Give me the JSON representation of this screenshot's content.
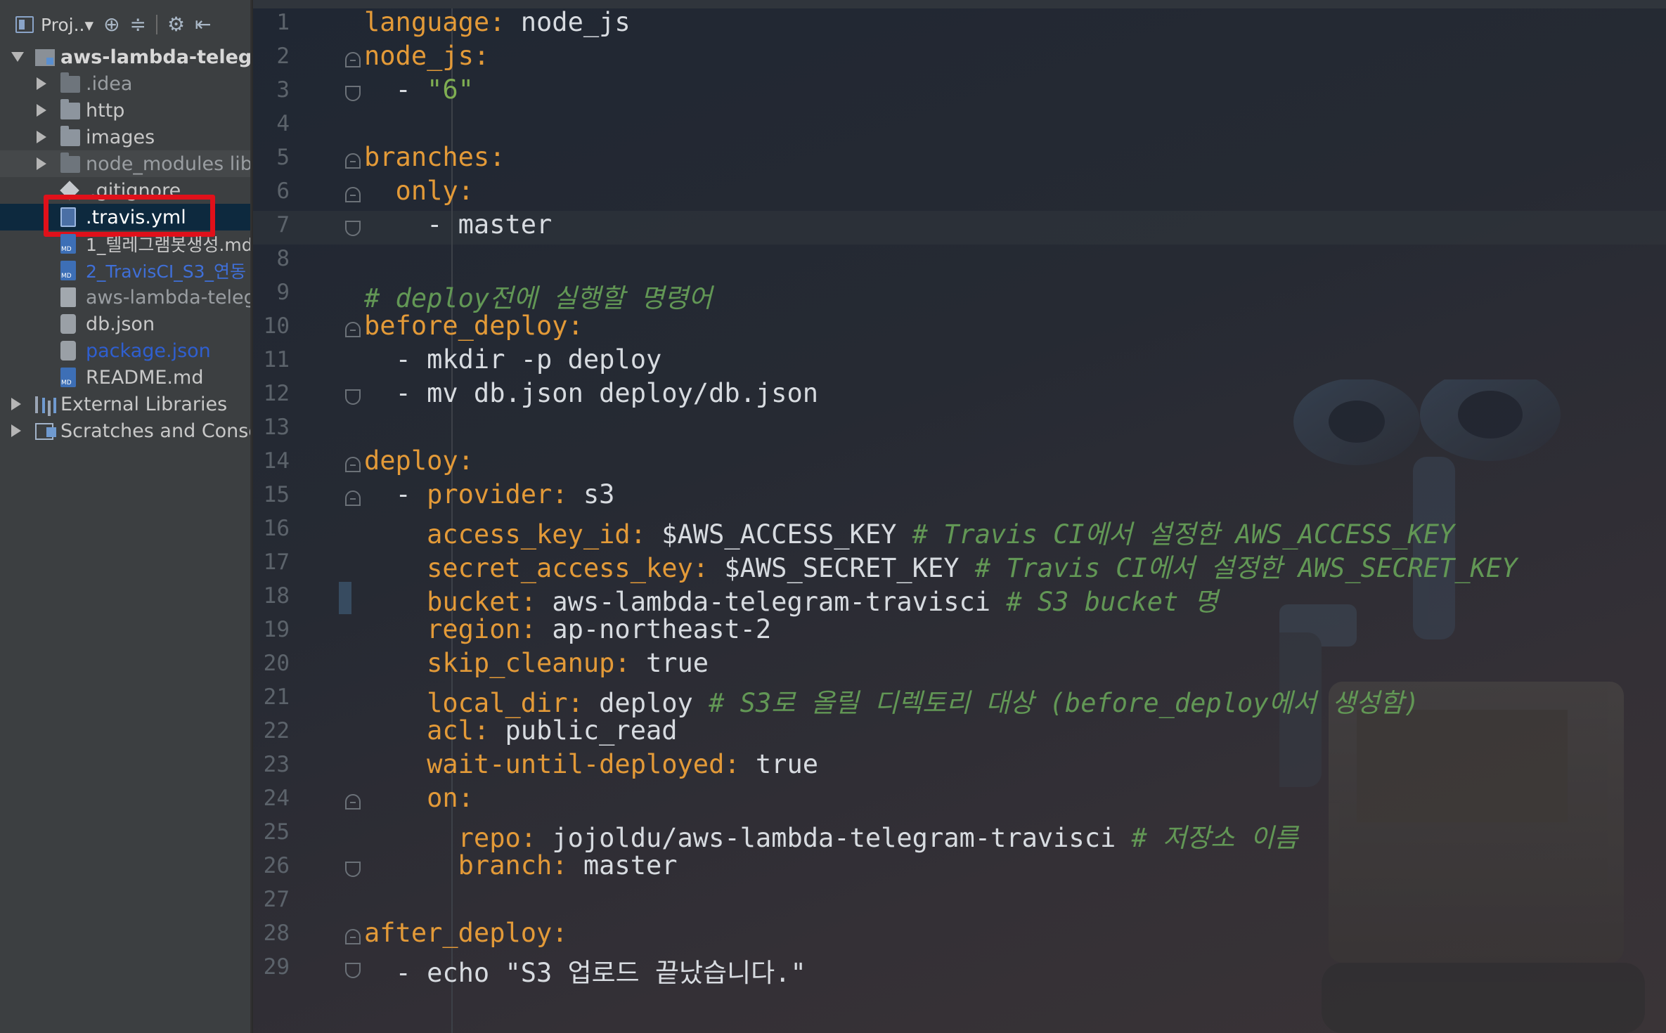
{
  "sidebar": {
    "toolbar": {
      "project_label": "Proj..▾",
      "icons": [
        "locate-icon",
        "collapse-icon",
        "gear-icon",
        "hide-icon"
      ]
    },
    "tree": [
      {
        "label": "aws-lambda-telegra",
        "icon": "project-folder-icon",
        "expanded": true
      },
      {
        "label": ".idea",
        "icon": "folder-icon"
      },
      {
        "label": "http",
        "icon": "folder-icon"
      },
      {
        "label": "images",
        "icon": "folder-icon"
      },
      {
        "label": "node_modules  lib",
        "icon": "folder-icon"
      },
      {
        "label": ".gitignore",
        "icon": "git-file-icon"
      },
      {
        "label": ".travis.yml",
        "icon": "yml-file-icon",
        "selected": true
      },
      {
        "label": "1_텔레그램봇생성.md",
        "icon": "md-file-icon"
      },
      {
        "label": "2_TravisCI_S3_연동",
        "icon": "md-file-icon"
      },
      {
        "label": "aws-lambda-teleg",
        "icon": "file-icon"
      },
      {
        "label": "db.json",
        "icon": "json-file-icon"
      },
      {
        "label": "package.json",
        "icon": "json-file-icon"
      },
      {
        "label": "README.md",
        "icon": "md-file-icon"
      },
      {
        "label": "External Libraries",
        "icon": "library-icon"
      },
      {
        "label": "Scratches and Conso",
        "icon": "scratch-icon"
      }
    ]
  },
  "editor": {
    "line_numbers": [
      "1",
      "2",
      "3",
      "4",
      "5",
      "6",
      "7",
      "8",
      "9",
      "10",
      "11",
      "12",
      "13",
      "14",
      "15",
      "16",
      "17",
      "18",
      "19",
      "20",
      "21",
      "22",
      "23",
      "24",
      "25",
      "26",
      "27",
      "28",
      "29"
    ],
    "code": {
      "l1_key": "language:",
      "l1_val": " node_js",
      "l2_key": "node_js:",
      "l3_dash": "  - ",
      "l3_val": "\"6\"",
      "l5_key": "branches:",
      "l6_key": "  only:",
      "l7_val": "    - master",
      "l9_comment": "# deploy전에 실행할 명령어",
      "l10_key": "before_deploy:",
      "l11_val": "  - mkdir -p deploy",
      "l12_val": "  - mv db.json deploy/db.json",
      "l14_key": "deploy:",
      "l15_dash": "  - ",
      "l15_key": "provider:",
      "l15_val": " s3",
      "l16_key": "    access_key_id:",
      "l16_val": " $AWS_ACCESS_KEY ",
      "l16_comment": "# Travis CI에서 설정한 AWS_ACCESS_KEY",
      "l17_key": "    secret_access_key:",
      "l17_val": " $AWS_SECRET_KEY ",
      "l17_comment": "# Travis CI에서 설정한 AWS_SECRET_KEY",
      "l18_key": "    bucket:",
      "l18_val": " aws-lambda-telegram-travisci ",
      "l18_comment": "# S3 bucket 명",
      "l19_key": "    region:",
      "l19_val": " ap-northeast-2",
      "l20_key": "    skip_cleanup:",
      "l20_val": " true",
      "l21_key": "    local_dir:",
      "l21_val": " deploy ",
      "l21_comment": "# S3로 올릴 디렉토리 대상 (before_deploy에서 생성함)",
      "l22_key": "    acl:",
      "l22_val": " public_read",
      "l23_key": "    wait-until-deployed:",
      "l23_val": " true",
      "l24_key": "    on:",
      "l25_key": "      repo:",
      "l25_val": " jojoldu/aws-lambda-telegram-travisci ",
      "l25_comment": "# 저장소 이름",
      "l26_key": "      branch:",
      "l26_val": " master",
      "l28_key": "after_deploy:",
      "l29_val": "  - echo \"S3 업로드 끝났습니다.\""
    },
    "colors": {
      "key": "#e39a38",
      "string": "#7fae52",
      "comment": "#629755",
      "text": "#d7dbe0",
      "highlight_box": "#e0101a"
    }
  }
}
